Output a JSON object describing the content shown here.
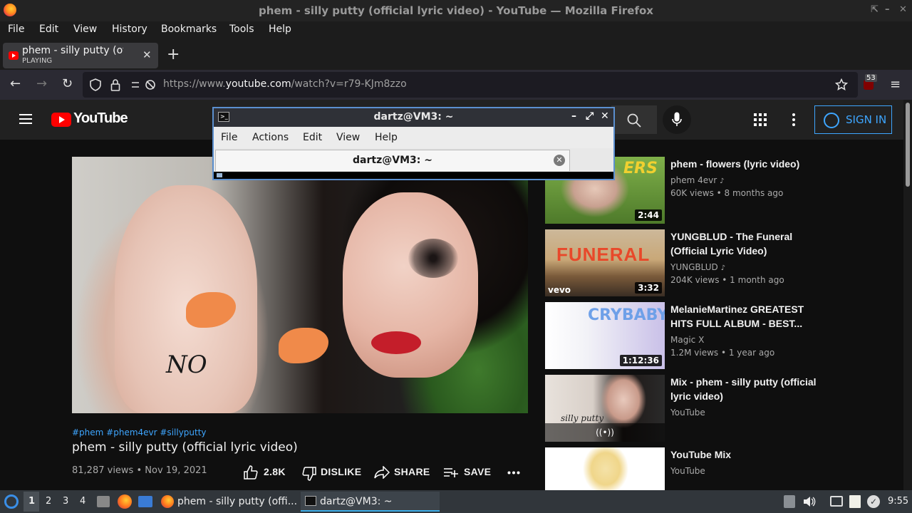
{
  "window": {
    "title": "phem - silly putty (official lyric video) - YouTube — Mozilla Firefox",
    "controls": [
      "⇱",
      "–",
      "✕"
    ]
  },
  "menubar": [
    "File",
    "Edit",
    "View",
    "History",
    "Bookmarks",
    "Tools",
    "Help"
  ],
  "tab": {
    "title": "phem - silly putty (official lyric video) - YouTube",
    "status": "PLAYING"
  },
  "navbar": {
    "url_prefix": "https://www.",
    "url_domain": "youtube.com",
    "url_path": "/watch?v=r79-KJm8zzo",
    "ublock_count": "53"
  },
  "youtube": {
    "logo_text": "YouTube",
    "signin_label": "SIGN IN"
  },
  "video": {
    "hashtags": "#phem #phem4evr #sillyputty",
    "title": "phem - silly putty (official lyric video)",
    "meta": "81,287 views • Nov 19, 2021",
    "overlay_text": "NO",
    "actions": {
      "like": "2.8K",
      "dislike": "DISLIKE",
      "share": "SHARE",
      "save": "SAVE"
    }
  },
  "related": [
    {
      "title": "phem - flowers (lyric video)",
      "channel": "phem 4evr",
      "meta": "60K views • 8 months ago",
      "duration": "2:44",
      "thumb_text": "ERS"
    },
    {
      "title": "YUNGBLUD - The Funeral (Official Lyric Video)",
      "channel": "YUNGBLUD",
      "meta": "204K views • 1 month ago",
      "duration": "3:32",
      "thumb_text": "FUNERAL",
      "badge": "vevo"
    },
    {
      "title": "MelanieMartinez GREATEST HITS FULL ALBUM - BEST...",
      "channel": "Magic X",
      "meta": "1.2M views • 1 year ago",
      "duration": "1:12:36",
      "thumb_text": "CRYBABY"
    },
    {
      "title": "Mix - phem - silly putty (official lyric video)",
      "channel": "YouTube",
      "meta": "",
      "duration": "",
      "thumb_text": "silly putty"
    },
    {
      "title": "YouTube Mix",
      "channel": "YouTube",
      "meta": "",
      "duration": "",
      "thumb_text": ""
    }
  ],
  "terminal": {
    "title": "dartz@VM3: ~",
    "menu": [
      "File",
      "Actions",
      "Edit",
      "View",
      "Help"
    ],
    "tab_label": "dartz@VM3: ~"
  },
  "taskbar": {
    "workspaces": [
      "1",
      "2",
      "3",
      "4"
    ],
    "tasks": [
      {
        "label": "phem - silly putty (offi..."
      },
      {
        "label": "dartz@VM3: ~"
      }
    ],
    "clock": "9:55"
  },
  "colors": {
    "yt_red": "#ff0000",
    "yt_blue": "#3ea6ff",
    "terminal_border": "#5b8fcf"
  }
}
